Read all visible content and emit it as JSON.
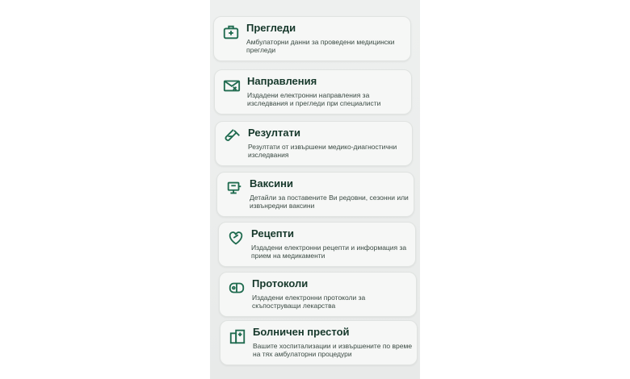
{
  "menu": {
    "items": [
      {
        "icon": "medical-bag-icon",
        "title": "Прегледи",
        "description": "Амбулаторни данни за проведени медицински прегледи"
      },
      {
        "icon": "referral-envelope-icon",
        "title": "Направления",
        "description": "Издадени електронни направления за изследвания и прегледи при специалисти"
      },
      {
        "icon": "test-tube-icon",
        "title": "Резултати",
        "description": "Резултати от извършени медико-диагностични изследвания"
      },
      {
        "icon": "syringe-icon",
        "title": "Ваксини",
        "description": "Детайли за поставените Ви редовни, сезонни или извънредни ваксини"
      },
      {
        "icon": "pills-icon",
        "title": "Рецепти",
        "description": "Издадени електронни рецепти и информация за прием на медикаменти"
      },
      {
        "icon": "protocol-pills-icon",
        "title": "Протоколи",
        "description": "Издадени електронни протоколи за скъпоструващи лекарства"
      },
      {
        "icon": "hospital-icon",
        "title": "Болничен престой",
        "description": "Вашите хоспитализации и извършените по време на тях амбулаторни процедури"
      }
    ]
  },
  "colors": {
    "accent": "#1f6b4f",
    "title": "#16382b",
    "card": "#f6f7f6"
  }
}
